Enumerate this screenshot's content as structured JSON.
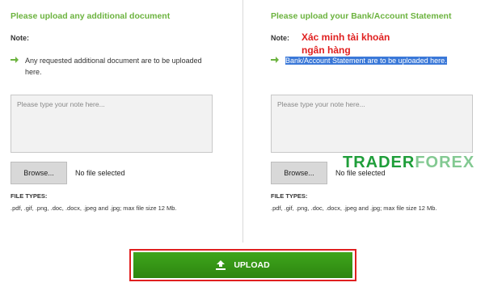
{
  "left_panel": {
    "title": "Please upload any additional document",
    "note_label": "Note:",
    "bullet": "Any requested additional document are to be uploaded here.",
    "textarea_placeholder": "Please type your note here...",
    "browse_label": "Browse...",
    "file_status": "No file selected",
    "file_types_label": "FILE TYPES:",
    "file_types_value": ".pdf, .gif, .png, .doc, .docx, .jpeg and .jpg; max file size 12 Mb."
  },
  "right_panel": {
    "title": "Please upload your Bank/Account Statement",
    "note_label": "Note:",
    "bullet": "Bank/Account Statement are to be uploaded here.",
    "textarea_placeholder": "Please type your note here...",
    "browse_label": "Browse...",
    "file_status": "No file selected",
    "file_types_label": "FILE TYPES:",
    "file_types_value": ".pdf, .gif, .png, .doc, .docx, .jpeg and .jpg; max file size 12 Mb."
  },
  "annotation": {
    "line1": "Xác minh tài khoản",
    "line2": "ngân hàng"
  },
  "watermark": {
    "part1": "TRADER",
    "part2": "FOREX"
  },
  "upload_button": {
    "label": "UPLOAD",
    "icon": "upload-icon"
  },
  "colors": {
    "accent_green": "#6cb33f",
    "button_green": "#2d8610",
    "highlight_blue": "#3a78d8",
    "annotation_red": "#e02020"
  }
}
